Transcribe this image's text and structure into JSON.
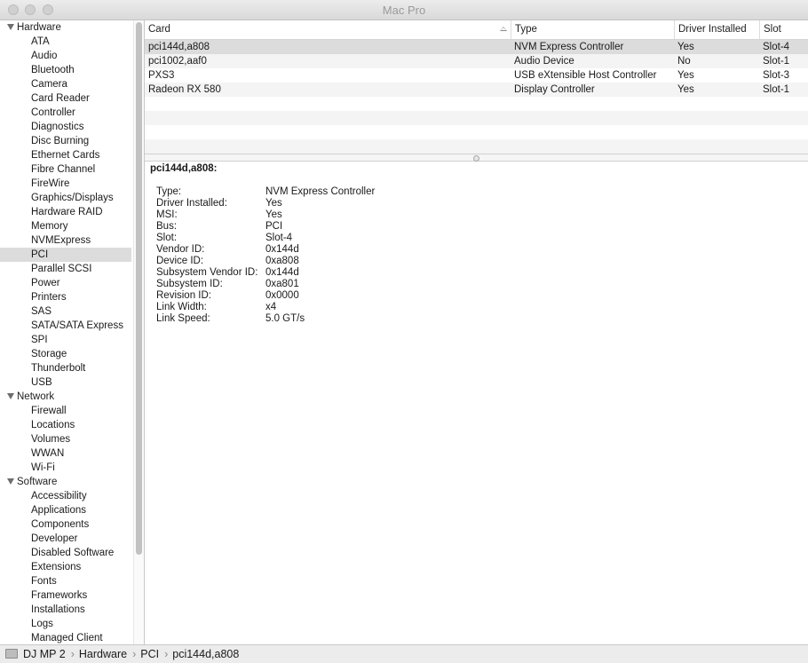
{
  "window": {
    "title": "Mac Pro"
  },
  "sidebar": {
    "groups": [
      {
        "label": "Hardware",
        "items": [
          "ATA",
          "Audio",
          "Bluetooth",
          "Camera",
          "Card Reader",
          "Controller",
          "Diagnostics",
          "Disc Burning",
          "Ethernet Cards",
          "Fibre Channel",
          "FireWire",
          "Graphics/Displays",
          "Hardware RAID",
          "Memory",
          "NVMExpress",
          "PCI",
          "Parallel SCSI",
          "Power",
          "Printers",
          "SAS",
          "SATA/SATA Express",
          "SPI",
          "Storage",
          "Thunderbolt",
          "USB"
        ]
      },
      {
        "label": "Network",
        "items": [
          "Firewall",
          "Locations",
          "Volumes",
          "WWAN",
          "Wi-Fi"
        ]
      },
      {
        "label": "Software",
        "items": [
          "Accessibility",
          "Applications",
          "Components",
          "Developer",
          "Disabled Software",
          "Extensions",
          "Fonts",
          "Frameworks",
          "Installations",
          "Logs",
          "Managed Client"
        ]
      }
    ],
    "selected": "PCI"
  },
  "table": {
    "columns": [
      "Card",
      "Type",
      "Driver Installed",
      "Slot"
    ],
    "rows": [
      [
        "pci144d,a808",
        "NVM Express Controller",
        "Yes",
        "Slot-4"
      ],
      [
        "pci1002,aaf0",
        "Audio Device",
        "No",
        "Slot-1"
      ],
      [
        "PXS3",
        "USB eXtensible Host Controller",
        "Yes",
        "Slot-3"
      ],
      [
        "Radeon RX 580",
        "Display Controller",
        "Yes",
        "Slot-1"
      ]
    ],
    "selected_row": 0
  },
  "detail": {
    "title": "pci144d,a808:",
    "properties": [
      [
        "Type:",
        "NVM Express Controller"
      ],
      [
        "Driver Installed:",
        "Yes"
      ],
      [
        "MSI:",
        "Yes"
      ],
      [
        "Bus:",
        "PCI"
      ],
      [
        "Slot:",
        "Slot-4"
      ],
      [
        "Vendor ID:",
        "0x144d"
      ],
      [
        "Device ID:",
        "0xa808"
      ],
      [
        "Subsystem Vendor ID:",
        "0x144d"
      ],
      [
        "Subsystem ID:",
        "0xa801"
      ],
      [
        "Revision ID:",
        "0x0000"
      ],
      [
        "Link Width:",
        "x4"
      ],
      [
        "Link Speed:",
        "5.0 GT/s"
      ]
    ]
  },
  "statusbar": {
    "path": [
      "DJ MP 2",
      "Hardware",
      "PCI",
      "pci144d,a808"
    ]
  }
}
